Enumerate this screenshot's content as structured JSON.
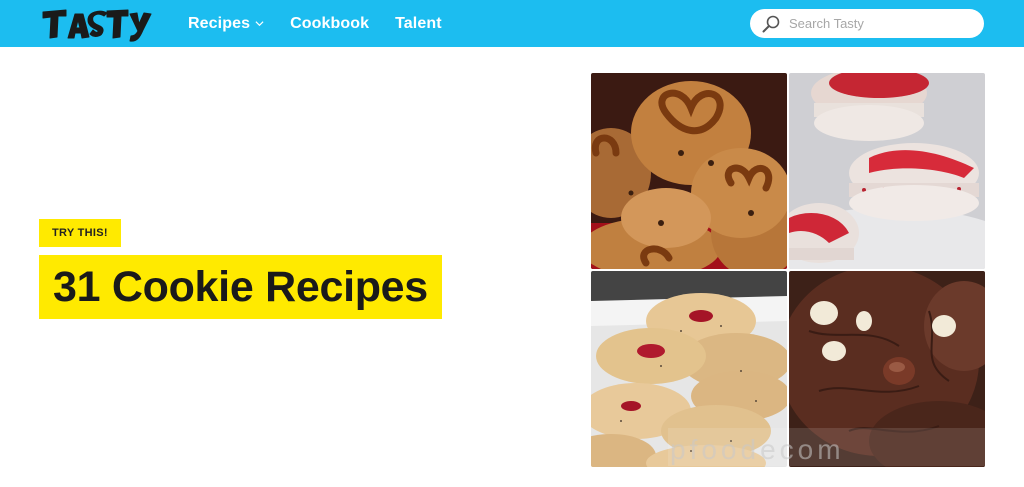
{
  "header": {
    "logo_text": "Tasty",
    "nav": [
      {
        "label": "Recipes",
        "has_dropdown": true
      },
      {
        "label": "Cookbook",
        "has_dropdown": false
      },
      {
        "label": "Talent",
        "has_dropdown": false
      }
    ],
    "search": {
      "placeholder": "Search Tasty",
      "value": ""
    }
  },
  "hero": {
    "badge": "TRY THIS!",
    "title": "31 Cookie Recipes",
    "images": [
      {
        "name": "pretzel-cookies-image",
        "icon": "photo"
      },
      {
        "name": "peppermint-macarons-image",
        "icon": "photo"
      },
      {
        "name": "linzer-cookies-image",
        "icon": "photo"
      },
      {
        "name": "chocolate-white-chip-cookies-image",
        "icon": "photo"
      }
    ]
  },
  "watermark": "pfoodecom",
  "colors": {
    "header_bg": "#1cbdf0",
    "highlight": "#ffea00",
    "text_dark": "#1a1a1a",
    "white": "#ffffff"
  }
}
